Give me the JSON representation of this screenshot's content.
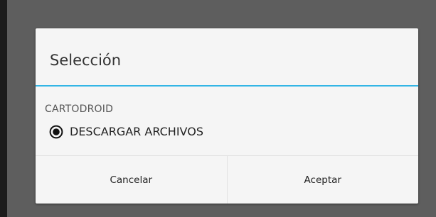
{
  "dialog": {
    "title": "Selección",
    "section_header": "CARTODROID",
    "options": [
      {
        "label": "DESCARGAR ARCHIVOS",
        "selected": true
      }
    ],
    "buttons": {
      "cancel_label": "Cancelar",
      "accept_label": "Aceptar"
    }
  },
  "colors": {
    "accent": "#33b5e5",
    "scrim": "#5e5e5e",
    "dialog_background": "#f5f5f5"
  }
}
